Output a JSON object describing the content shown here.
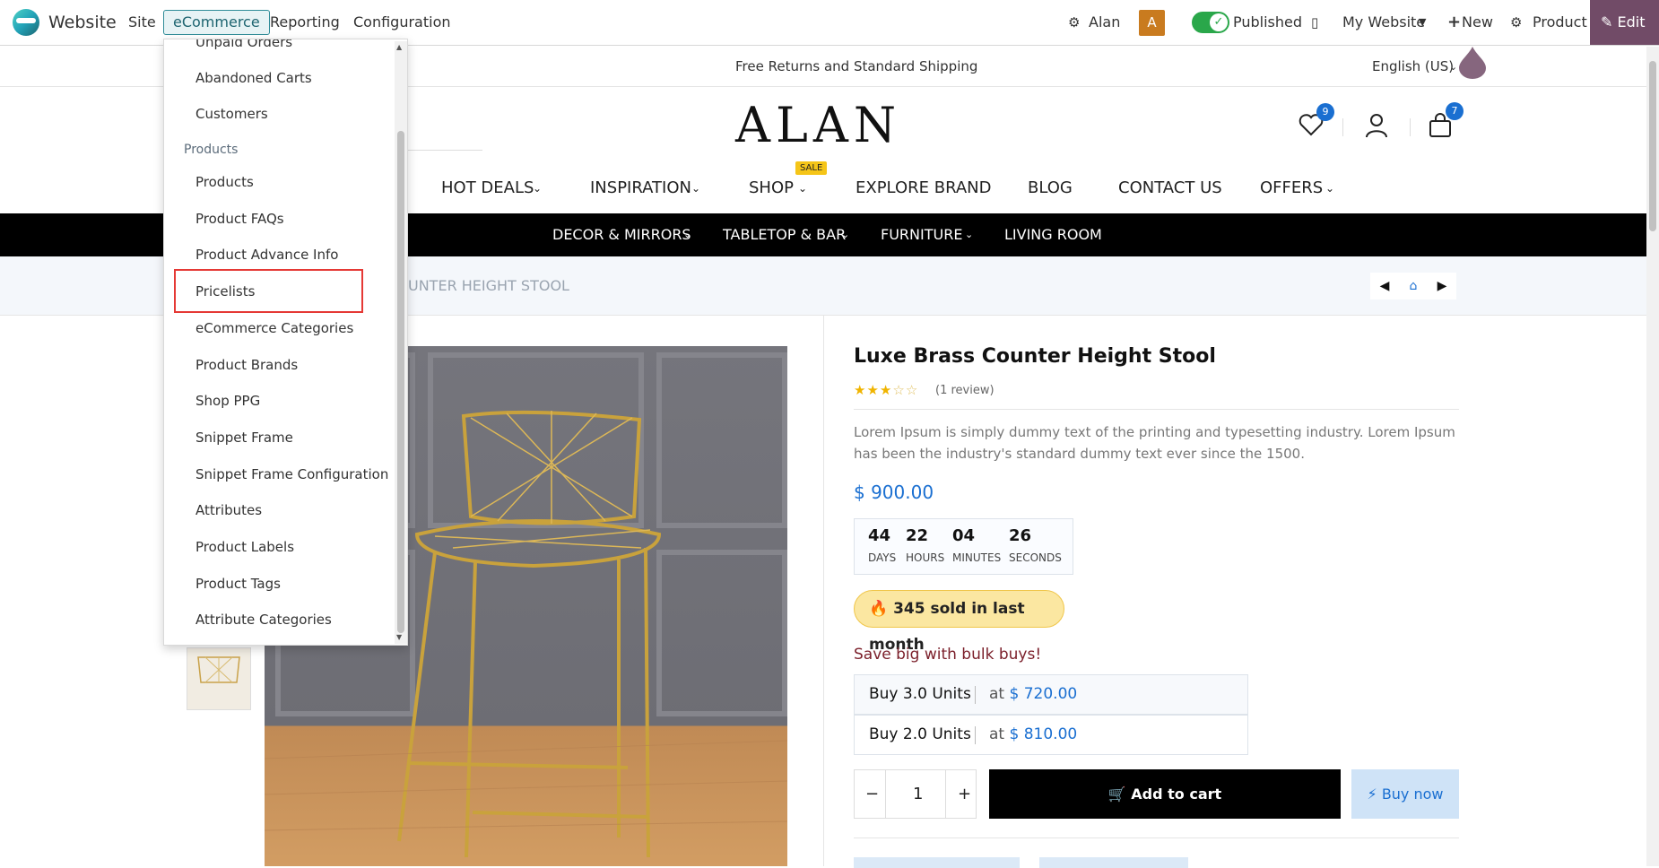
{
  "topbar": {
    "app_name": "Website",
    "menus": [
      "Site",
      "eCommerce",
      "Reporting",
      "Configuration"
    ],
    "user_name": "Alan",
    "avatar_letter": "A",
    "published_label": "Published",
    "website_selector": "My Website",
    "new_label": "New",
    "product_label": "Product",
    "edit_label": "Edit"
  },
  "site": {
    "promo_text": "Free Returns and Standard Shipping",
    "language": "English (US)",
    "brand": "ALAN",
    "wishlist_count": "9",
    "cart_count": "7",
    "nav": [
      "HOT DEALS",
      "INSPIRATION",
      "SHOP",
      "EXPLORE BRAND",
      "BLOG",
      "CONTACT US",
      "OFFERS"
    ],
    "sale_tag": "SALE",
    "subnav": [
      "DECOR & MIRRORS",
      "TABLETOP & BAR",
      "FURNITURE",
      "LIVING ROOM"
    ],
    "breadcrumb_visible": "UNTER HEIGHT STOOL"
  },
  "product": {
    "title": "Luxe Brass Counter Height Stool",
    "rating_stars": 3,
    "reviews": "(1 review)",
    "description": "Lorem Ipsum is simply dummy text of the printing and typesetting industry. Lorem Ipsum has been the industry's standard dummy text ever since the 1500.",
    "price": "$ 900.00",
    "timer": {
      "days": "44",
      "days_label": "DAYS",
      "hours": "22",
      "hours_label": "HOURS",
      "minutes": "04",
      "minutes_label": "MINUTES",
      "seconds": "26",
      "seconds_label": "SECONDS"
    },
    "sold_text": "345 sold in last month",
    "bulk_title": "Save big with bulk buys!",
    "bulk": [
      {
        "units": "Buy 3.0 Units",
        "at": "at",
        "price": "$ 720.00"
      },
      {
        "units": "Buy 2.0 Units",
        "at": "at",
        "price": "$ 810.00"
      }
    ],
    "qty": "1",
    "qty_minus": "−",
    "qty_plus": "+",
    "add_to_cart": "Add to cart",
    "buy_now": "Buy now"
  },
  "menu": {
    "top_partial": "Unpaid Orders",
    "items_before": [
      "Abandoned Carts",
      "Customers"
    ],
    "section": "Products",
    "items": [
      "Products",
      "Product FAQs",
      "Product Advance Info",
      "Pricelists",
      "eCommerce Categories",
      "Product Brands",
      "Shop PPG",
      "Snippet Frame",
      "Snippet Frame Configuration",
      "Attributes",
      "Product Labels",
      "Product Tags",
      "Attribute Categories"
    ],
    "highlighted": "Pricelists"
  },
  "colors": {
    "accent": "#714b67",
    "price_blue": "#1a6fd1",
    "published_green": "#2aa74a",
    "highlight_red": "#e53935"
  },
  "icons": [
    "gear-icon",
    "mobile-icon",
    "plus-icon",
    "pencil-icon",
    "heart-icon",
    "user-icon",
    "bag-icon",
    "home-icon",
    "fire-icon",
    "bolt-icon",
    "cart-icon"
  ]
}
